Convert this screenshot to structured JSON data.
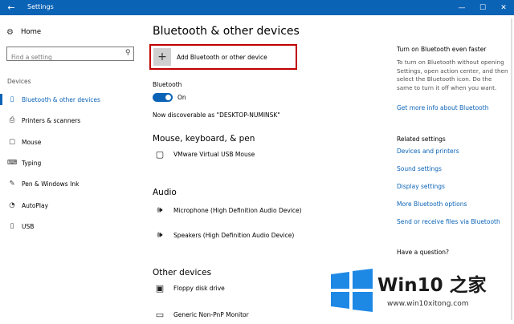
{
  "window": {
    "title": "Settings",
    "back_icon": "back-arrow-icon",
    "controls": [
      "—",
      "☐",
      "✕"
    ]
  },
  "sidebar": {
    "home_label": "Home",
    "search_placeholder": "Find a setting",
    "section_label": "Devices",
    "items": [
      {
        "label": "Bluetooth & other devices",
        "icon": "bluetooth-icon",
        "active": true
      },
      {
        "label": "Printers & scanners",
        "icon": "printer-icon",
        "active": false
      },
      {
        "label": "Mouse",
        "icon": "mouse-icon",
        "active": false
      },
      {
        "label": "Typing",
        "icon": "keyboard-icon",
        "active": false
      },
      {
        "label": "Pen & Windows Ink",
        "icon": "pen-icon",
        "active": false
      },
      {
        "label": "AutoPlay",
        "icon": "autoplay-icon",
        "active": false
      },
      {
        "label": "USB",
        "icon": "usb-icon",
        "active": false
      }
    ]
  },
  "main": {
    "title": "Bluetooth & other devices",
    "add_button_label": "Add Bluetooth or other device",
    "bluetooth_label": "Bluetooth",
    "bluetooth_state": "On",
    "discoverable_text": "Now discoverable as \"DESKTOP-NUMINSK\"",
    "groups": {
      "mouse": {
        "title": "Mouse, keyboard, & pen",
        "devices": [
          "VMware Virtual USB Mouse"
        ]
      },
      "audio": {
        "title": "Audio",
        "devices": [
          "Microphone (High Definition Audio Device)",
          "Speakers (High Definition Audio Device)"
        ]
      },
      "other": {
        "title": "Other devices",
        "devices": [
          "Floppy disk drive",
          "Generic Non-PnP Monitor"
        ]
      }
    }
  },
  "right": {
    "heading": "Turn on Bluetooth even faster",
    "body": "To turn on Bluetooth without opening Settings, open action center, and then select the Bluetooth icon. Do the same to turn it off when you want.",
    "more_info_link": "Get more info about Bluetooth",
    "related_heading": "Related settings",
    "related_links": [
      "Devices and printers",
      "Sound settings",
      "Display settings",
      "More Bluetooth options",
      "Send or receive files via Bluetooth"
    ],
    "question_heading": "Have a question?"
  },
  "watermark": {
    "brand": "Win10 之家",
    "url": "www.win10xitong.com"
  },
  "colors": {
    "accent": "#0b63b6",
    "highlight_border": "#c00000"
  }
}
